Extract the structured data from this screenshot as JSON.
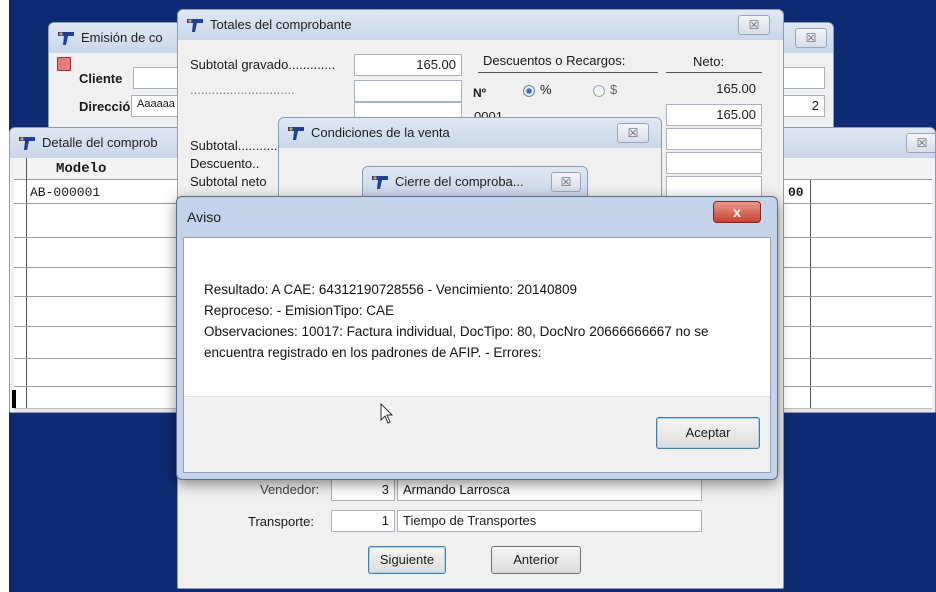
{
  "colors": {
    "desktop": "#0e2a73",
    "dialog_frame": "#c3d4ea",
    "close_red": "#c9412e"
  },
  "emision": {
    "title": "Emisión de co",
    "cliente_label": "Cliente",
    "direccion_label": "Dirección",
    "direccion_value": "Aaaaaa",
    "right_value": "2"
  },
  "detalle": {
    "title": "Detalle del comprob",
    "col_modelo": "Modelo",
    "row1_modelo": "AB-000001",
    "row1_partial": "00"
  },
  "totales": {
    "title": "Totales del comprobante",
    "subtotal_gravado_label": "Subtotal gravado.............",
    "subtotal_gravado_value": "165.00",
    "descuentos_label": "Descuentos o Recargos:",
    "neto_label": "Neto:",
    "nro_label": "Nº",
    "pct_label": "%",
    "dollar_label": "$",
    "neto_value1": "165.00",
    "row_code": "0001",
    "neto_value2": "165.00",
    "subtotal_label": "Subtotal..............",
    "descuento_label": "Descuento..",
    "subtotal_neto_label": "Subtotal neto"
  },
  "condiciones": {
    "title": "Condiciones de la venta"
  },
  "cierre": {
    "title": "Cierre del comproba..."
  },
  "venta": {
    "vendedor_label": "Vendedor:",
    "vendedor_num": "3",
    "vendedor_name": "Armando Larrosca",
    "transporte_label": "Transporte:",
    "transporte_num": "1",
    "transporte_name": "Tiempo de Transportes",
    "siguiente": "Siguiente",
    "anterior": "Anterior"
  },
  "aviso": {
    "title": "Aviso",
    "close": "x",
    "line1": "Resultado: A CAE: 64312190728556 - Vencimiento: 20140809",
    "line2": "Reproceso:  - EmisionTipo: CAE",
    "line3": "Observaciones: 10017: Factura individual, DocTipo: 80, DocNro 20666666667 no se",
    "line4": "encuentra registrado en los padrones de AFIP. - Errores:",
    "button": "Aceptar"
  },
  "close_glyph": "☒"
}
